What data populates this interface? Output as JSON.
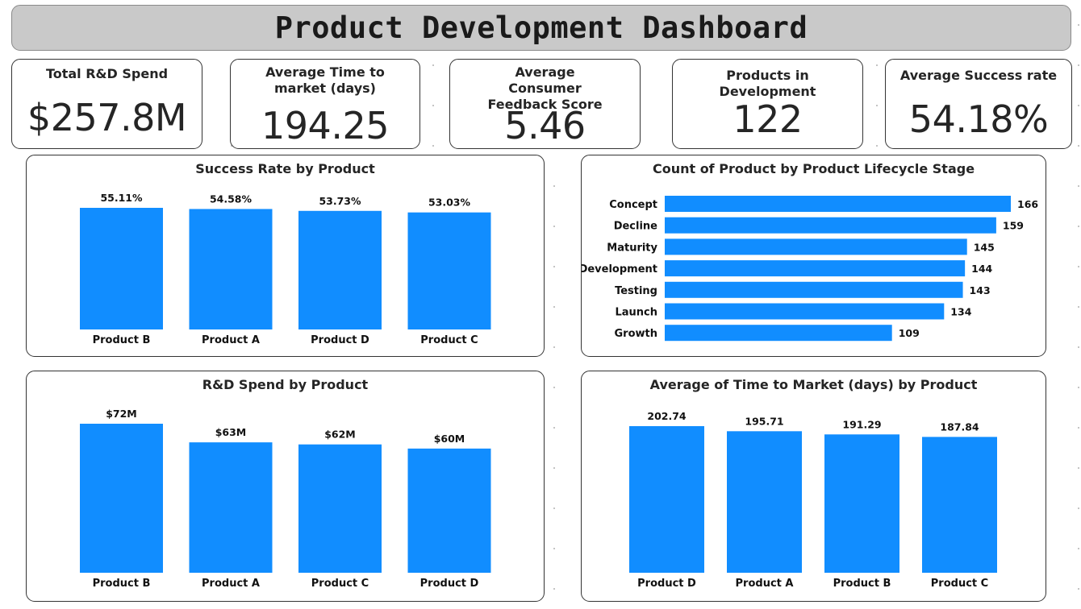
{
  "header": {
    "title": "Product Development Dashboard"
  },
  "kpis": [
    {
      "label": "Total R&D Spend",
      "value": "$257.8M"
    },
    {
      "label": "Average Time to market (days)",
      "value": "194.25"
    },
    {
      "label": "Average Consumer Feedback Score",
      "value": "5.46"
    },
    {
      "label": "Products in Development",
      "value": "122"
    },
    {
      "label": "Average Success rate",
      "value": "54.18%"
    }
  ],
  "colors": {
    "bar": "#118DFF",
    "banner": "#C9C9C9",
    "text": "#252525"
  },
  "charts": {
    "success_rate": {
      "title": "Success Rate by Product"
    },
    "lifecycle": {
      "title": "Count of Product by Product Lifecycle Stage"
    },
    "rd_spend": {
      "title": "R&D Spend by Product"
    },
    "time_to_market": {
      "title": "Average of Time to Market (days) by Product"
    }
  },
  "chart_data": [
    {
      "id": "success_rate",
      "type": "bar",
      "title": "Success Rate by Product",
      "categories": [
        "Product B",
        "Product A",
        "Product D",
        "Product C"
      ],
      "values": [
        55.11,
        54.58,
        53.73,
        53.03
      ],
      "data_labels": [
        "55.11%",
        "54.58%",
        "53.73%",
        "53.03%"
      ],
      "unit": "%",
      "baseline": 0
    },
    {
      "id": "lifecycle",
      "type": "bar",
      "orientation": "horizontal",
      "title": "Count of Product by Product Lifecycle Stage",
      "categories": [
        "Concept",
        "Decline",
        "Maturity",
        "Development",
        "Testing",
        "Launch",
        "Growth"
      ],
      "values": [
        166,
        159,
        145,
        144,
        143,
        134,
        109
      ],
      "data_labels": [
        "166",
        "159",
        "145",
        "144",
        "143",
        "134",
        "109"
      ]
    },
    {
      "id": "rd_spend",
      "type": "bar",
      "title": "R&D Spend by Product",
      "categories": [
        "Product B",
        "Product A",
        "Product C",
        "Product D"
      ],
      "values": [
        72,
        63,
        62,
        60
      ],
      "data_labels": [
        "$72M",
        "$63M",
        "$62M",
        "$60M"
      ],
      "unit": "$M"
    },
    {
      "id": "time_to_market",
      "type": "bar",
      "title": "Average of Time to Market (days) by Product",
      "categories": [
        "Product D",
        "Product A",
        "Product B",
        "Product C"
      ],
      "values": [
        202.74,
        195.71,
        191.29,
        187.84
      ],
      "data_labels": [
        "202.74",
        "195.71",
        "191.29",
        "187.84"
      ]
    }
  ]
}
